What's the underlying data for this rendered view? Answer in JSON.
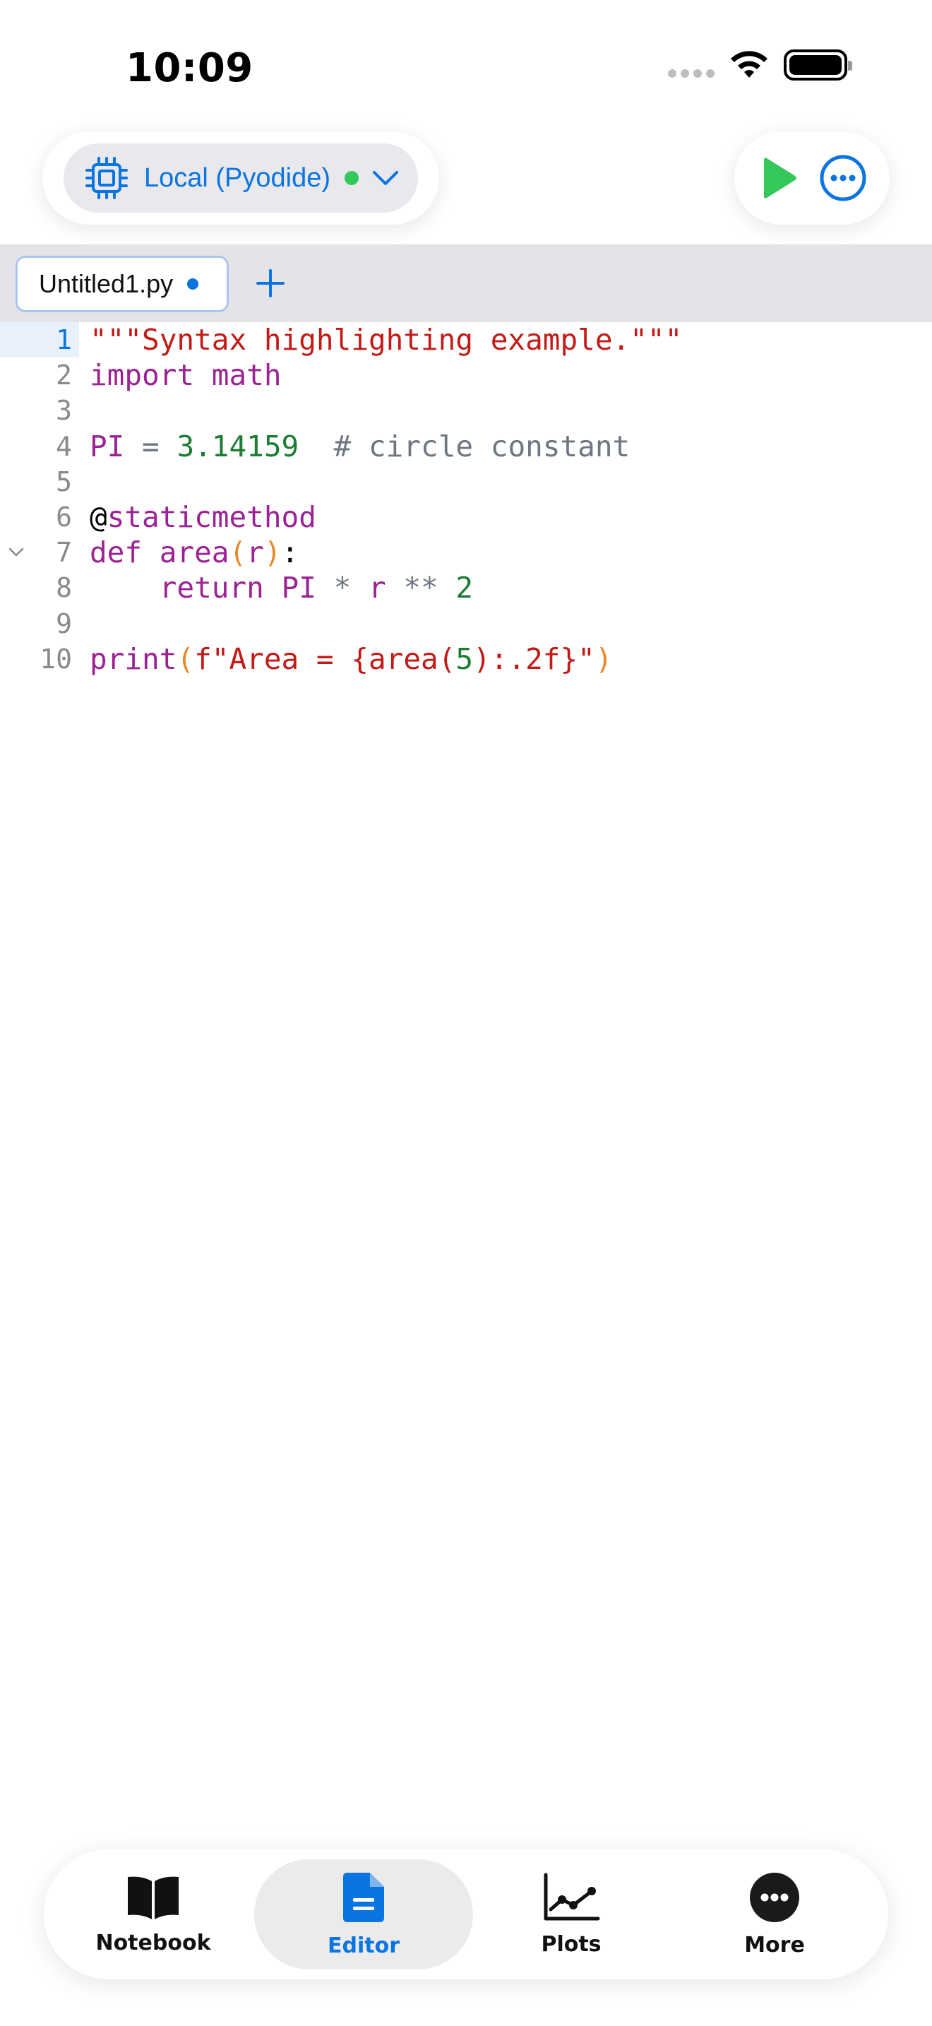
{
  "status_bar": {
    "time": "10:09"
  },
  "kernel": {
    "label": "Local (Pyodide)",
    "status_color": "#34c759"
  },
  "tabs": [
    {
      "label": "Untitled1.py",
      "modified": true
    }
  ],
  "editor": {
    "active_line": 1,
    "lines": [
      {
        "number": "1",
        "tokens": [
          {
            "t": "\"\"\"Syntax highlighting example.\"\"\"",
            "c": "str"
          }
        ]
      },
      {
        "number": "2",
        "tokens": [
          {
            "t": "import math",
            "c": "kw"
          }
        ]
      },
      {
        "number": "3",
        "tokens": []
      },
      {
        "number": "4",
        "tokens": [
          {
            "t": "PI",
            "c": "kw"
          },
          {
            "t": " = ",
            "c": "op"
          },
          {
            "t": "3.14159",
            "c": "num"
          },
          {
            "t": "  # circle constant",
            "c": "cm"
          }
        ]
      },
      {
        "number": "5",
        "tokens": []
      },
      {
        "number": "6",
        "tokens": [
          {
            "t": "@",
            "c": "plain"
          },
          {
            "t": "staticmethod",
            "c": "kw"
          }
        ]
      },
      {
        "number": "7",
        "tokens": [
          {
            "t": "def area",
            "c": "kw"
          },
          {
            "t": "(",
            "c": "par"
          },
          {
            "t": "r",
            "c": "kw"
          },
          {
            "t": ")",
            "c": "par"
          },
          {
            "t": ":",
            "c": "plain"
          }
        ],
        "foldable": true
      },
      {
        "number": "8",
        "tokens": [
          {
            "t": "    return PI ",
            "c": "kw"
          },
          {
            "t": "* ",
            "c": "op"
          },
          {
            "t": "r ",
            "c": "kw"
          },
          {
            "t": "** ",
            "c": "op"
          },
          {
            "t": "2",
            "c": "num"
          }
        ]
      },
      {
        "number": "9",
        "tokens": []
      },
      {
        "number": "10",
        "tokens": [
          {
            "t": "print",
            "c": "kw"
          },
          {
            "t": "(",
            "c": "par"
          },
          {
            "t": "f\"Area = {area(",
            "c": "str"
          },
          {
            "t": "5",
            "c": "num"
          },
          {
            "t": "):.2f}\"",
            "c": "str"
          },
          {
            "t": ")",
            "c": "par"
          }
        ]
      }
    ]
  },
  "bottom_tabs": [
    {
      "label": "Notebook",
      "icon": "book-icon",
      "selected": false
    },
    {
      "label": "Editor",
      "icon": "document-icon",
      "selected": true
    },
    {
      "label": "Plots",
      "icon": "line-chart-icon",
      "selected": false
    },
    {
      "label": "More",
      "icon": "ellipsis-circle-icon",
      "selected": false
    }
  ],
  "colors": {
    "accent": "#0a74e0",
    "run": "#34c759"
  }
}
